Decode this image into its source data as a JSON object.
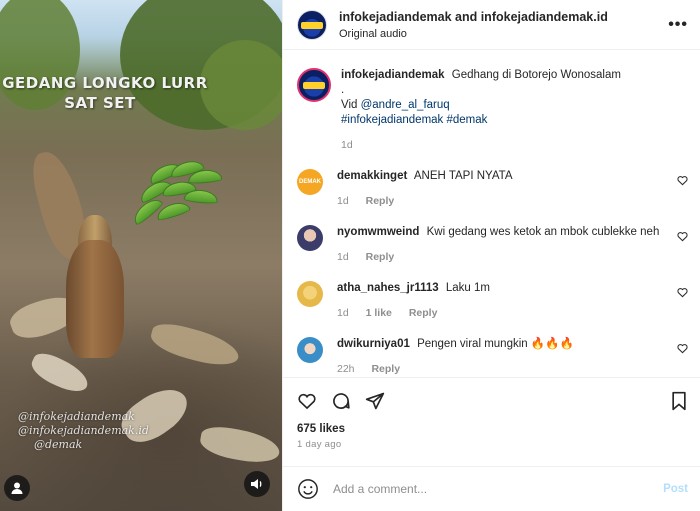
{
  "media": {
    "overlay_line1": "GEDANG LONGKO LURR",
    "overlay_line2": "SAT SET",
    "watermark_1": "@infokejadiandemak",
    "watermark_2": "@infokejadiandemak.id",
    "watermark_3": "@demak",
    "sound_icon": "speaker-icon",
    "avatar_icon": "user-icon"
  },
  "header": {
    "title": "infokejadiandemak and infokejadiandemak.id",
    "subtitle": "Original audio",
    "more_icon": "more-icon"
  },
  "caption": {
    "username": "infokejadiandemak",
    "text": "Gedhang di Botorejo Wonosalam",
    "dot": ".",
    "vid_prefix": "Vid ",
    "mention": "@andre_al_faruq",
    "hashtags": "#infokejadiandemak #demak",
    "time": "1d"
  },
  "comments": [
    {
      "username": "demakkinget",
      "text": "ANEH TAPI NYATA",
      "time": "1d",
      "likes": "",
      "reply": "Reply",
      "avatar_color": "#f5a623"
    },
    {
      "username": "nyomwmweind",
      "text": "Kwi gedang wes ketok an mbok cublekke neh",
      "time": "1d",
      "likes": "",
      "reply": "Reply",
      "avatar_color": "#5a5a8a"
    },
    {
      "username": "atha_nahes_jr1113",
      "text": "Laku 1m",
      "time": "1d",
      "likes": "1 like",
      "reply": "Reply",
      "avatar_color": "#f0c84a"
    },
    {
      "username": "dwikurniya01",
      "text": "Pengen viral mungkin 🔥🔥🔥",
      "time": "22h",
      "likes": "",
      "reply": "Reply",
      "avatar_color": "#3a8ec7"
    }
  ],
  "stats": {
    "likes": "675 likes",
    "age": "1 day ago"
  },
  "composer": {
    "placeholder": "Add a comment...",
    "post": "Post"
  },
  "colors": {
    "brand_blue": "#1a3fa8",
    "brand_yellow": "#ffd12a",
    "link": "#00376b",
    "muted": "#8e8e8e",
    "post_disabled": "#b2dffc"
  }
}
